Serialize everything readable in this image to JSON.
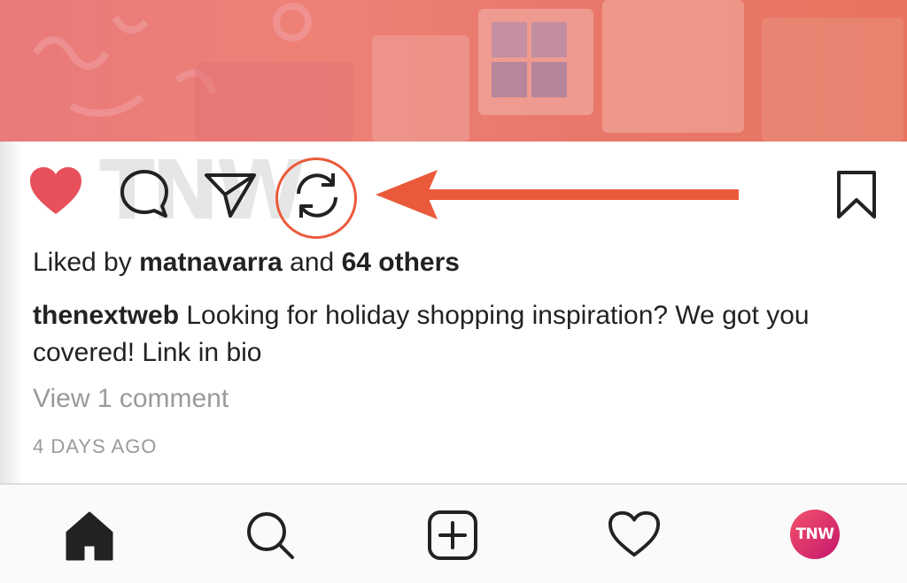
{
  "post": {
    "liked_by_prefix": "Liked by ",
    "liked_by_user": "matnavarra",
    "liked_by_and": " and ",
    "liked_by_others": "64 others",
    "caption_user": "thenextweb",
    "caption_text": " Looking for holiday shopping inspiration? We got you covered! Link in bio",
    "view_comments": "View 1 comment",
    "timestamp": "4 DAYS AGO"
  },
  "watermark": "TNW",
  "avatar_text": "TNW",
  "icons": {
    "like": "heart-filled-icon",
    "comment": "comment-bubble-icon",
    "share": "paper-plane-icon",
    "repost": "refresh-icon",
    "save": "bookmark-icon",
    "nav_home": "home-icon",
    "nav_search": "search-icon",
    "nav_add": "plus-square-icon",
    "nav_activity": "heart-outline-icon"
  },
  "colors": {
    "like_red": "#e8505b",
    "annotation_orange": "#ea5a3a",
    "avatar_gradient_start": "#f4526b",
    "avatar_gradient_end": "#c4176e"
  }
}
